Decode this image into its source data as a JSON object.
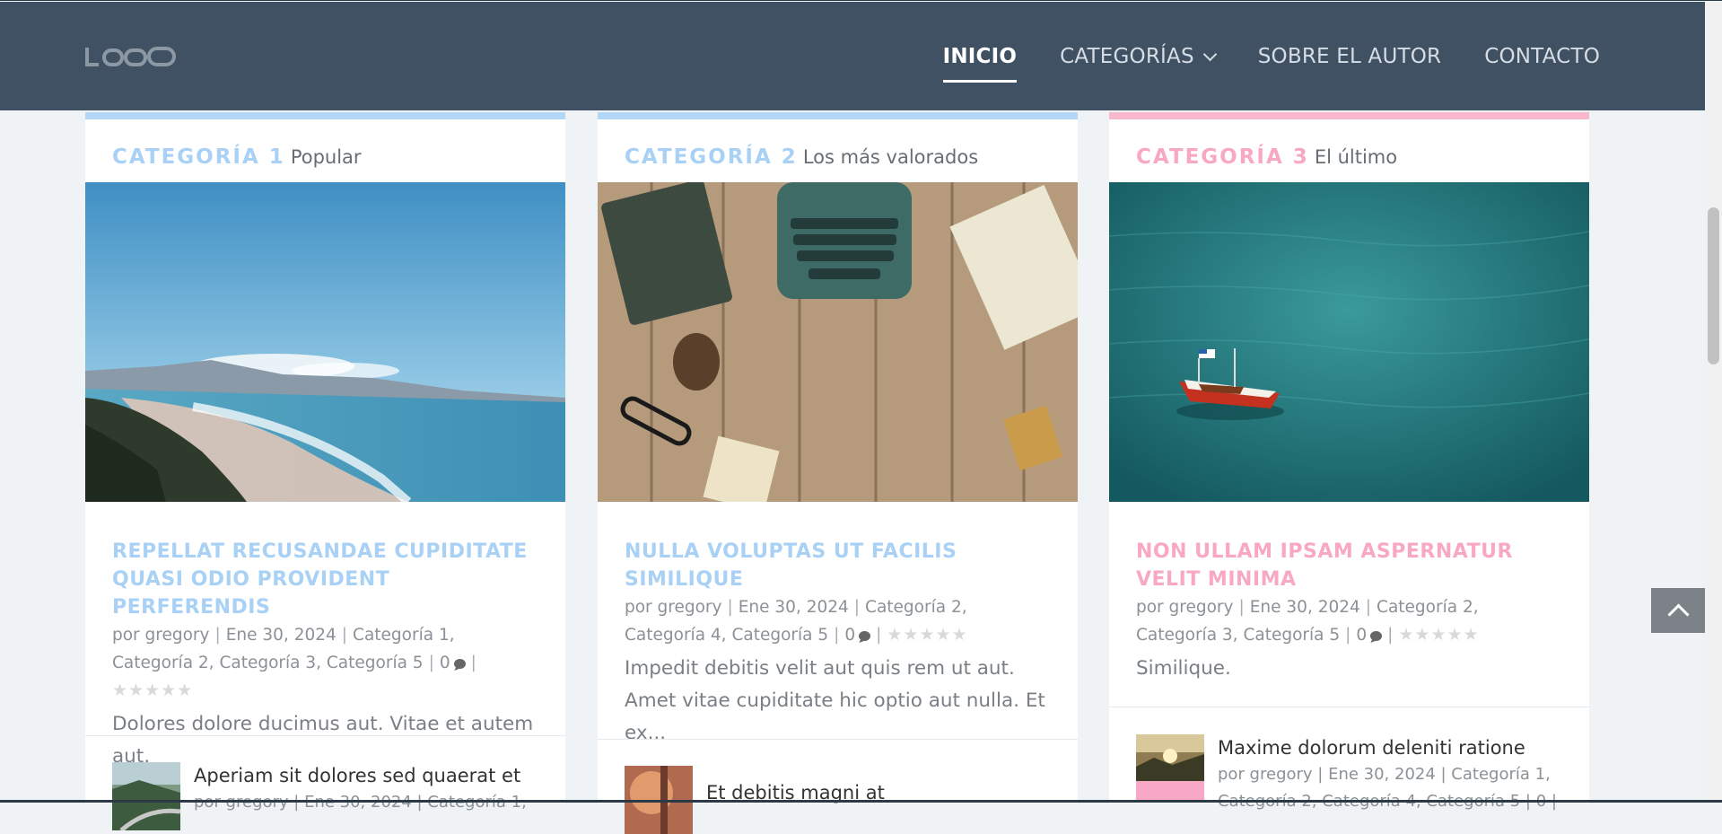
{
  "header": {
    "logo_text": "LOGO",
    "nav": [
      {
        "label": "INICIO",
        "active": true
      },
      {
        "label": "CATEGORÍAS",
        "dropdown": true
      },
      {
        "label": "SOBRE EL AUTOR"
      },
      {
        "label": "CONTACTO"
      }
    ]
  },
  "cards": [
    {
      "category": "CATEGORÍA 1",
      "subtitle": "Popular",
      "accent": "#a8d1f5",
      "image": "coastal-beach-landscape",
      "post": {
        "title": "REPELLAT RECUSANDAE CUPIDITATE QUASI ODIO PROVIDENT PERFERENDIS",
        "meta_author": "por gregory",
        "meta_date": "Ene 30, 2024",
        "meta_cats": "Categoría 1, Categoría 2, Categoría 3, Categoría 5",
        "comments": "0",
        "rating_stars": 0,
        "excerpt": "Dolores dolore ducimus aut. Vitae et autem aut."
      },
      "mini": {
        "title": "Aperiam sit dolores sed quaerat et",
        "meta": "por gregory | Ene 30, 2024 | Categoría 1,"
      }
    },
    {
      "category": "CATEGORÍA 2",
      "subtitle": "Los más valorados",
      "accent": "#a8d1f5",
      "image": "typewriter-on-wood-desk",
      "post": {
        "title": "NULLA VOLUPTAS UT FACILIS SIMILIQUE",
        "meta_author": "por gregory",
        "meta_date": "Ene 30, 2024",
        "meta_cats": "Categoría 2, Categoría 4, Categoría 5",
        "comments": "0",
        "rating_stars": 0,
        "excerpt": "Impedit debitis velit aut quis rem ut aut. Amet vitae cupiditate hic optio aut nulla. Et ex..."
      },
      "mini": {
        "title": "Et debitis magni at",
        "meta": ""
      }
    },
    {
      "category": "CATEGORÍA 3",
      "subtitle": "El último",
      "accent": "#f8a8c4",
      "image": "red-boat-on-turquoise-sea",
      "post": {
        "title": "NON ULLAM IPSAM ASPERNATUR VELIT MINIMA",
        "meta_author": "por gregory",
        "meta_date": "Ene 30, 2024",
        "meta_cats": "Categoría 2, Categoría 3, Categoría 5",
        "comments": "0",
        "rating_stars": 0,
        "excerpt": "Similique."
      },
      "mini": {
        "title": "Maxime dolorum deleniti ratione",
        "meta": "por gregory | Ene 30, 2024 | Categoría 1,",
        "meta2": "Categoría 2, Categoría 4, Categoría 5 | 0 |"
      }
    }
  ]
}
